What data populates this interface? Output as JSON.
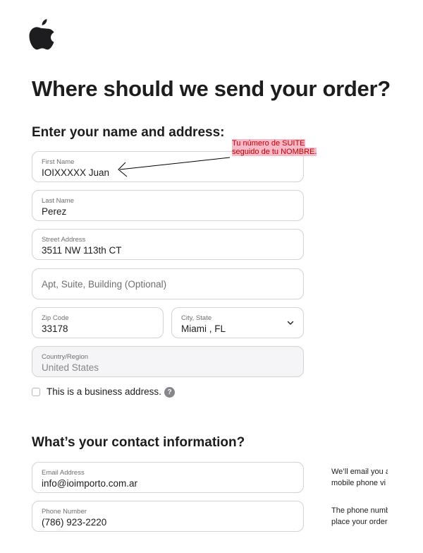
{
  "header": {
    "logo_icon": "apple-logo-icon",
    "title": "Where should we send your order?"
  },
  "address_section": {
    "title": "Enter your name and address:",
    "first_name": {
      "label": "First Name",
      "value": "IOIXXXXX Juan"
    },
    "last_name": {
      "label": "Last Name",
      "value": "Perez"
    },
    "street": {
      "label": "Street Address",
      "value": "3511 NW 113th CT"
    },
    "apt": {
      "placeholder": "Apt, Suite, Building (Optional)"
    },
    "zip": {
      "label": "Zip Code",
      "value": "33178"
    },
    "city_state": {
      "label": "City, State",
      "value": "Miami , FL",
      "icon": "chevron-down-icon"
    },
    "country": {
      "label": "Country/Region",
      "value": "United States"
    },
    "business_checkbox": {
      "label": "This is a business address.",
      "checked": false,
      "help_icon": "?"
    }
  },
  "annotation": {
    "line1": "Tu número de SUITE",
    "line2": "seguido de tu NOMBRE.",
    "color": "#c00000",
    "highlight": "#f7b9c8"
  },
  "contact_section": {
    "title": "What’s your contact information?",
    "email": {
      "label": "Email Address",
      "value": "info@ioimporto.com.ar"
    },
    "phone": {
      "label": "Phone Number",
      "value": "(786) 923-2220"
    },
    "email_note": {
      "line1": "We’ll email you a",
      "line2": "mobile phone vi"
    },
    "phone_note": {
      "line1": "The phone numb",
      "line2": "place your order"
    }
  }
}
